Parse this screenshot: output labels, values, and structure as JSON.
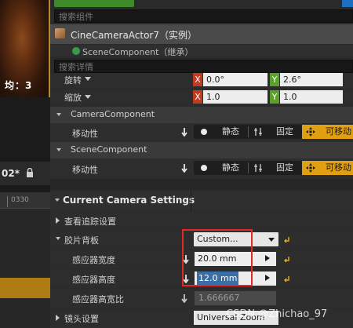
{
  "viewport": {
    "count_text": "均：3",
    "sequencer_time": "02*",
    "ruler_label": "0330"
  },
  "header": {
    "component_search_placeholder": "搜索组件",
    "actor_label": "CineCameraActor7（实例）",
    "scene_component_label": "SceneComponent（继承）",
    "detail_search_placeholder": "搜索详情"
  },
  "transform": {
    "rotation_label": "旋转",
    "rotation_x": "0.0°",
    "rotation_y": "2.6°",
    "scale_label": "缩放",
    "scale_x": "1.0",
    "scale_y": "1.0",
    "axis_x": "X",
    "axis_y": "Y"
  },
  "camera_component": {
    "title": "CameraComponent",
    "mobility_label": "移动性",
    "static": "静态",
    "stationary": "固定",
    "movable": "可移动"
  },
  "scene_component": {
    "title": "SceneComponent",
    "mobility_label": "移动性",
    "static": "静态",
    "stationary": "固定",
    "movable": "可移动"
  },
  "camera_settings": {
    "title": "Current Camera Settings",
    "lookat_tracking": "查看追踪设置",
    "filmback": "胶片背板",
    "filmback_preset": "Custom...",
    "sensor_width_label": "感应器宽度",
    "sensor_width": "20.0 mm",
    "sensor_height_label": "感应器高度",
    "sensor_height": "12.0 mm",
    "aspect_ratio_label": "感应器高宽比",
    "aspect_ratio": "1.666667",
    "lens_settings": "镜头设置",
    "lens_preset": "Universal Zoom"
  },
  "watermark": "CSDN @Zhichao_97",
  "colors": {
    "movable_active": "#e0a012",
    "highlight_box": "#e02a2a",
    "axis_x": "#c23a1f",
    "axis_y": "#5aa02a"
  }
}
